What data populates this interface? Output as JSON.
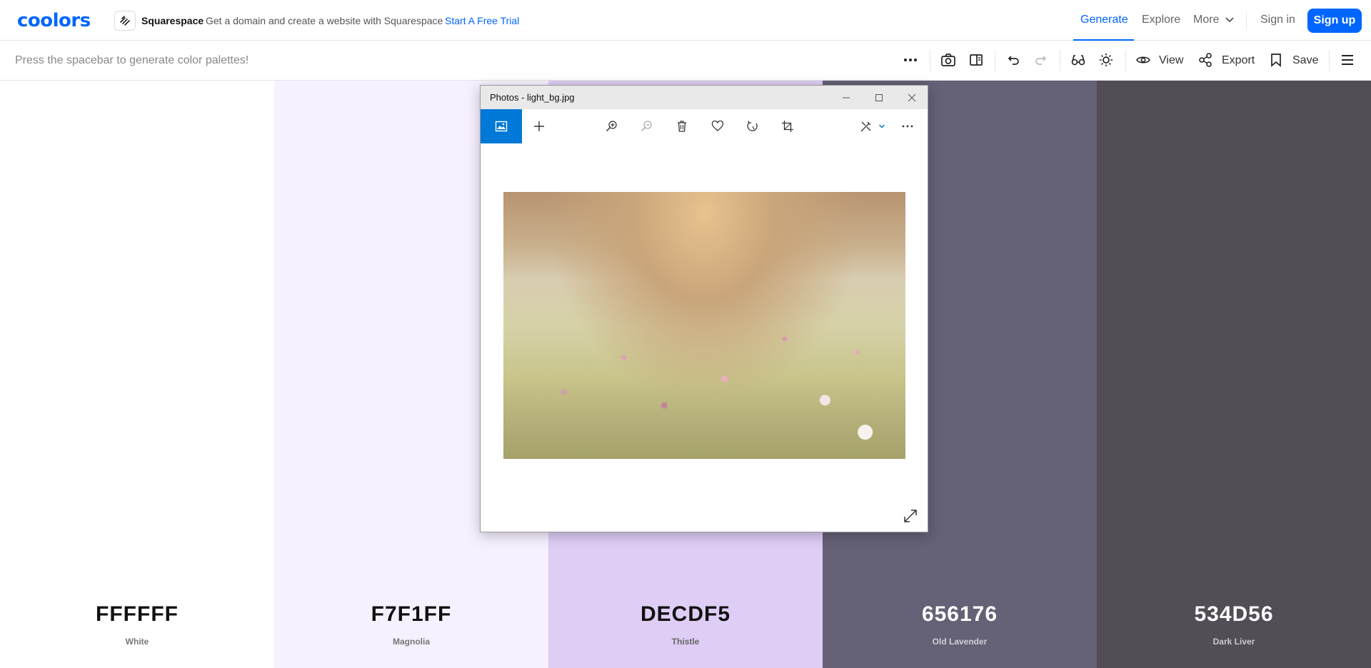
{
  "topnav": {
    "logo": "coolors",
    "ad_brand": "Squarespace",
    "ad_text": "Get a domain and create a website with Squarespace",
    "ad_cta": "Start A Free Trial",
    "links": {
      "generate": "Generate",
      "explore": "Explore",
      "more": "More",
      "signin": "Sign in"
    },
    "signup": "Sign up",
    "accent_color": "#0066ff"
  },
  "toolbar": {
    "hint": "Press the spacebar to generate color palettes!",
    "icons": [
      "more-dots-icon",
      "camera-icon",
      "sidebar-layout-icon",
      "undo-icon",
      "redo-icon",
      "glasses-icon",
      "sun-icon",
      "eye-icon",
      "share-icon",
      "bookmark-icon",
      "hamburger-menu-icon"
    ],
    "view": "View",
    "export": "Export",
    "save": "Save"
  },
  "palette": [
    {
      "hex": "FFFFFF",
      "name": "White",
      "bg": "#FFFFFF",
      "text": "#111111",
      "sub": "#777777"
    },
    {
      "hex": "F7F1FF",
      "name": "Magnolia",
      "bg": "#F7F1FF",
      "text": "#111111",
      "sub": "#777777"
    },
    {
      "hex": "DECDF5",
      "name": "Thistle",
      "bg": "#DECDF5",
      "text": "#111111",
      "sub": "#666666"
    },
    {
      "hex": "656176",
      "name": "Old Lavender",
      "bg": "#656176",
      "text": "#FFFFFF",
      "sub": "#d0cfd8"
    },
    {
      "hex": "534D56",
      "name": "Dark Liver",
      "bg": "#534D56",
      "text": "#FFFFFF",
      "sub": "#cdcacd"
    }
  ],
  "photos_window": {
    "title": "Photos - light_bg.jpg",
    "controls": [
      "minimize-icon",
      "maximize-icon",
      "close-icon"
    ],
    "tools": [
      "image-icon",
      "add-icon",
      "zoom-in-icon",
      "zoom-out-icon",
      "delete-icon",
      "heart-icon",
      "rotate-icon",
      "crop-icon",
      "edit-icon",
      "more-dots-icon"
    ],
    "active_color": "#0078d7"
  }
}
